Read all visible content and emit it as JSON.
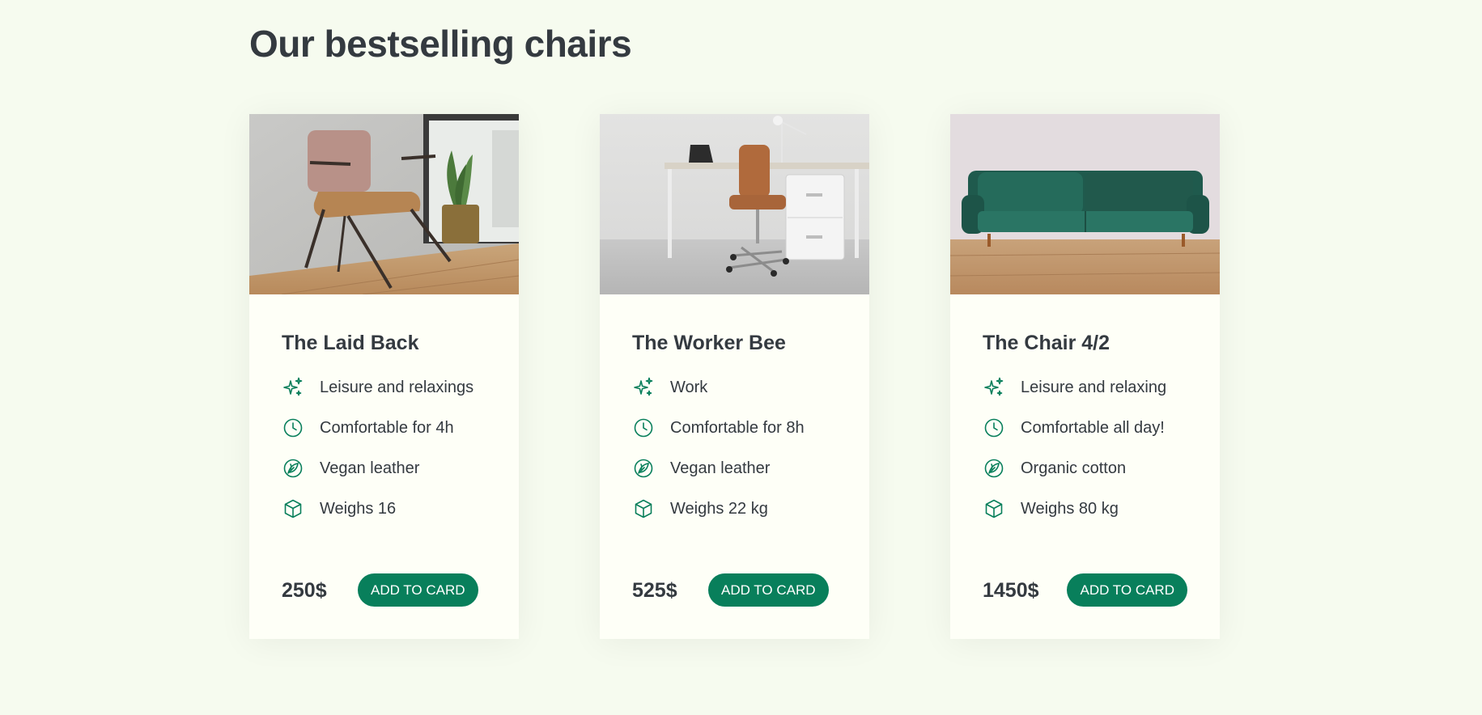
{
  "page": {
    "title": "Our bestselling chairs"
  },
  "colors": {
    "background": "#f6fbef",
    "card_background": "#fefff7",
    "accent": "#087f5b",
    "text": "#343a40"
  },
  "products": [
    {
      "title": "The Laid Back",
      "image_icon": "armchair-photo",
      "features": [
        {
          "icon": "sparkles-icon",
          "text": "Leisure and relaxings"
        },
        {
          "icon": "clock-icon",
          "text": "Comfortable for 4h"
        },
        {
          "icon": "leaf-icon",
          "text": "Vegan leather"
        },
        {
          "icon": "box-icon",
          "text": "Weighs 16"
        }
      ],
      "price": "250$",
      "button_label": "ADD TO CARD"
    },
    {
      "title": "The Worker Bee",
      "image_icon": "office-chair-photo",
      "features": [
        {
          "icon": "sparkles-icon",
          "text": "Work"
        },
        {
          "icon": "clock-icon",
          "text": "Comfortable for 8h"
        },
        {
          "icon": "leaf-icon",
          "text": "Vegan leather"
        },
        {
          "icon": "box-icon",
          "text": "Weighs 22 kg"
        }
      ],
      "price": "525$",
      "button_label": "ADD TO CARD"
    },
    {
      "title": "The Chair 4/2",
      "image_icon": "sofa-photo",
      "features": [
        {
          "icon": "sparkles-icon",
          "text": "Leisure and relaxing"
        },
        {
          "icon": "clock-icon",
          "text": "Comfortable all day!"
        },
        {
          "icon": "leaf-icon",
          "text": "Organic cotton"
        },
        {
          "icon": "box-icon",
          "text": "Weighs 80 kg"
        }
      ],
      "price": "1450$",
      "button_label": "ADD TO CARD"
    }
  ]
}
